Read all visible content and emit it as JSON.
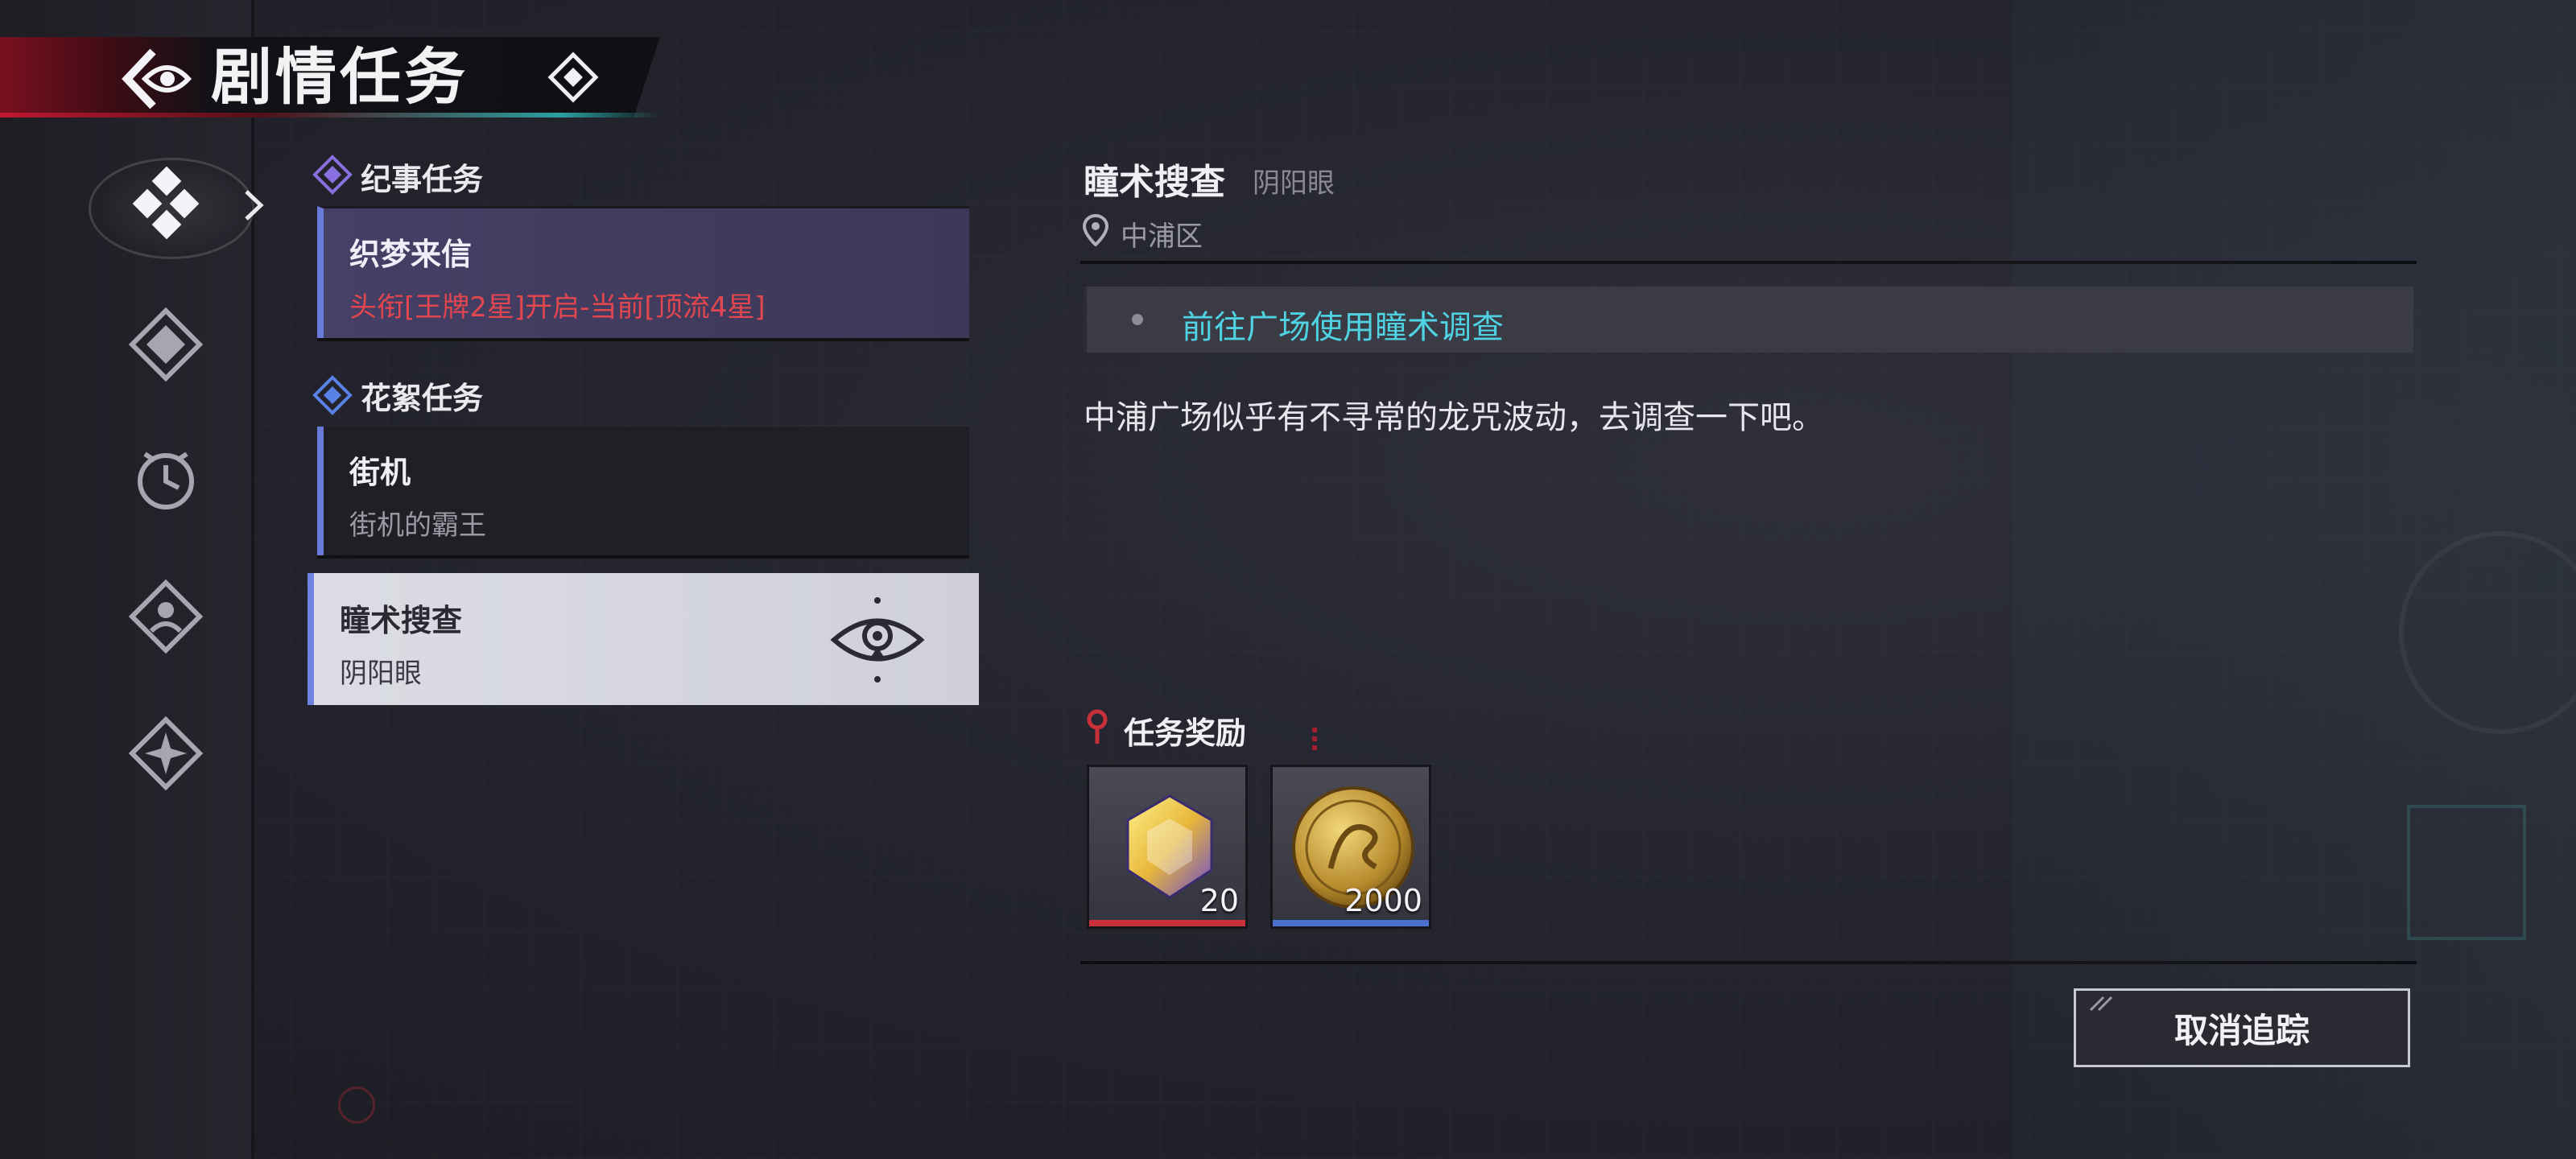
{
  "header": {
    "title": "剧情任务"
  },
  "sections": {
    "chronicle": {
      "title": "纪事任务"
    },
    "side": {
      "title": "花絮任务"
    }
  },
  "quests": [
    {
      "name": "织梦来信",
      "subtitle": "头衔[王牌2星]开启-当前[顶流4星]",
      "state": "locked"
    },
    {
      "name": "街机",
      "subtitle": "街机的霸王",
      "state": "normal"
    },
    {
      "name": "瞳术搜查",
      "subtitle": "阴阳眼",
      "state": "selected-tracked"
    }
  ],
  "detail": {
    "title": "瞳术搜查",
    "subtitle": "阴阳眼",
    "location": "中浦区",
    "objective": "前往广场使用瞳术调查",
    "description": "中浦广场似乎有不寻常的龙咒波动，去调查一下吧。"
  },
  "rewards": {
    "title": "任务奖励",
    "items": [
      {
        "icon": "yellow-gem-icon",
        "quantity": "20",
        "rarity_color": "#c8303a"
      },
      {
        "icon": "dragon-gold-coin-icon",
        "quantity": "2000",
        "rarity_color": "#4a6fd0"
      }
    ]
  },
  "buttons": {
    "cancel_tracking": "取消追踪"
  },
  "colors": {
    "accent_red": "#c01830",
    "objective_cyan": "#4fd3e2",
    "locked_red": "#e2464e",
    "card_selected_bg": "#dcdde4"
  }
}
